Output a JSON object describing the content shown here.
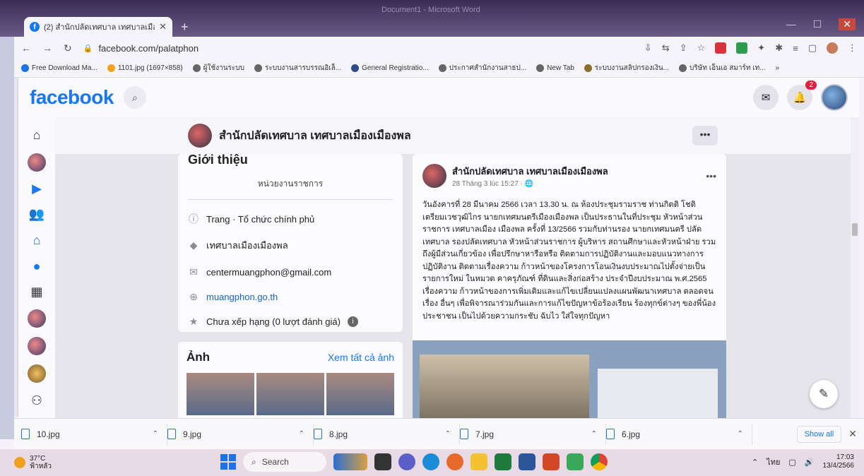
{
  "browser": {
    "word_title": "Document1 - Microsoft Word",
    "tab_title": "(2) สำนักปลัดเทศบาล เทศบาลเมืองเ...",
    "url": "facebook.com/palatphon",
    "bookmarks": [
      "Free Download Ma...",
      "1101.jpg (1697×858)",
      "ผู้ใช้งานระบบ",
      "ระบบงานสารบรรณอิเล็...",
      "General Registratio...",
      "ประกาศสำนักงานสาธป...",
      "New Tab",
      "ระบบงานสลิปกรองเงิน...",
      "บริษัท เอ็นเอ สมาร์ท เท..."
    ]
  },
  "facebook": {
    "logo": "facebook",
    "notification_count": "2",
    "page_name": "สำนักปลัดเทศบาล เทศบาลเมืองเมืองพล",
    "intro": {
      "title": "Giới thiệu",
      "category": "หน่วยงานราชการ",
      "rows": [
        "Trang · Tổ chức chính phủ",
        "เทศบาลเมืองเมืองพล",
        "centermuangphon@gmail.com",
        "muangphon.go.th",
        "Chưa xếp hạng (0 lượt đánh giá)"
      ]
    },
    "photos": {
      "title": "Ảnh",
      "see_all": "Xem tất cả ảnh"
    },
    "post": {
      "author": "สำนักปลัดเทศบาล เทศบาลเมืองเมืองพล",
      "time": "28 Tháng 3 lúc 15:27 · 🌐",
      "text": "วันอังคารที่ 28 มีนาคม 2566 เวลา 13.30 น. ณ ห้องประชุมรามราช ท่านกิตติ โชติ เตรียมเวชวุฒิไกร นายกเทศมนตรีเมืองเมืองพล เป็นประธานในที่ประชุม หัวหน้าส่วนราชการ เทศบาลเมือง เมืองพล ครั้งที่ 13/2566 รวมกับท่านรอง นายกเทศมนตรี ปลัดเทศบาล รองปลัดเทศบาล หัวหน้าส่วนราชการ ผู้บริหาร สถานศึกษาและหัวหน้าฝ่าย รวมถึงผู้มีส่วนเกี่ยวข้อง เพื่อปรึกษาหารือหรือ ติดตามการปฏิบัติงานและมอบแนวทางการปฏิบัติงาน ติดตามเรื่องความ ก้าวหน้าของโครงการโอนเงินงบประมาณไปตั้งจ่ายเป็นรายการใหม่ ในหมวด คาครุภัณฑ์ ที่ดินและสิ่งก่อสร้าง ประจำปีงบประมาณ พ.ศ.2565 เรื่องความ ก้าวหน้าของการเพิ่มเติมและแก้ไขเปลี่ยนแปลงแผนพัฒนาเทศบาล ตลอดจน เรื่อง อื่นๆ เพื่อพิจารณาร่วมกันและการแก้ไขปัญหาข้อร้องเรียน ร้องทุกข์ต่างๆ ของพี่น้องประชาชน เป็นไปด้วยความกระชับ ฉับไว ใส่ใจทุกปัญหา"
    }
  },
  "downloads": {
    "files": [
      "10.jpg",
      "9.jpg",
      "8.jpg",
      "7.jpg",
      "6.jpg"
    ],
    "show_all": "Show all"
  },
  "taskbar": {
    "temp": "37°C",
    "weather_desc": "ฟ้าหลัว",
    "search": "Search",
    "lang": "ไทย",
    "time": "17:03",
    "date": "13/4/2566"
  },
  "colors": {
    "fb_blue": "#1877f2",
    "link_blue": "#1565c0"
  }
}
